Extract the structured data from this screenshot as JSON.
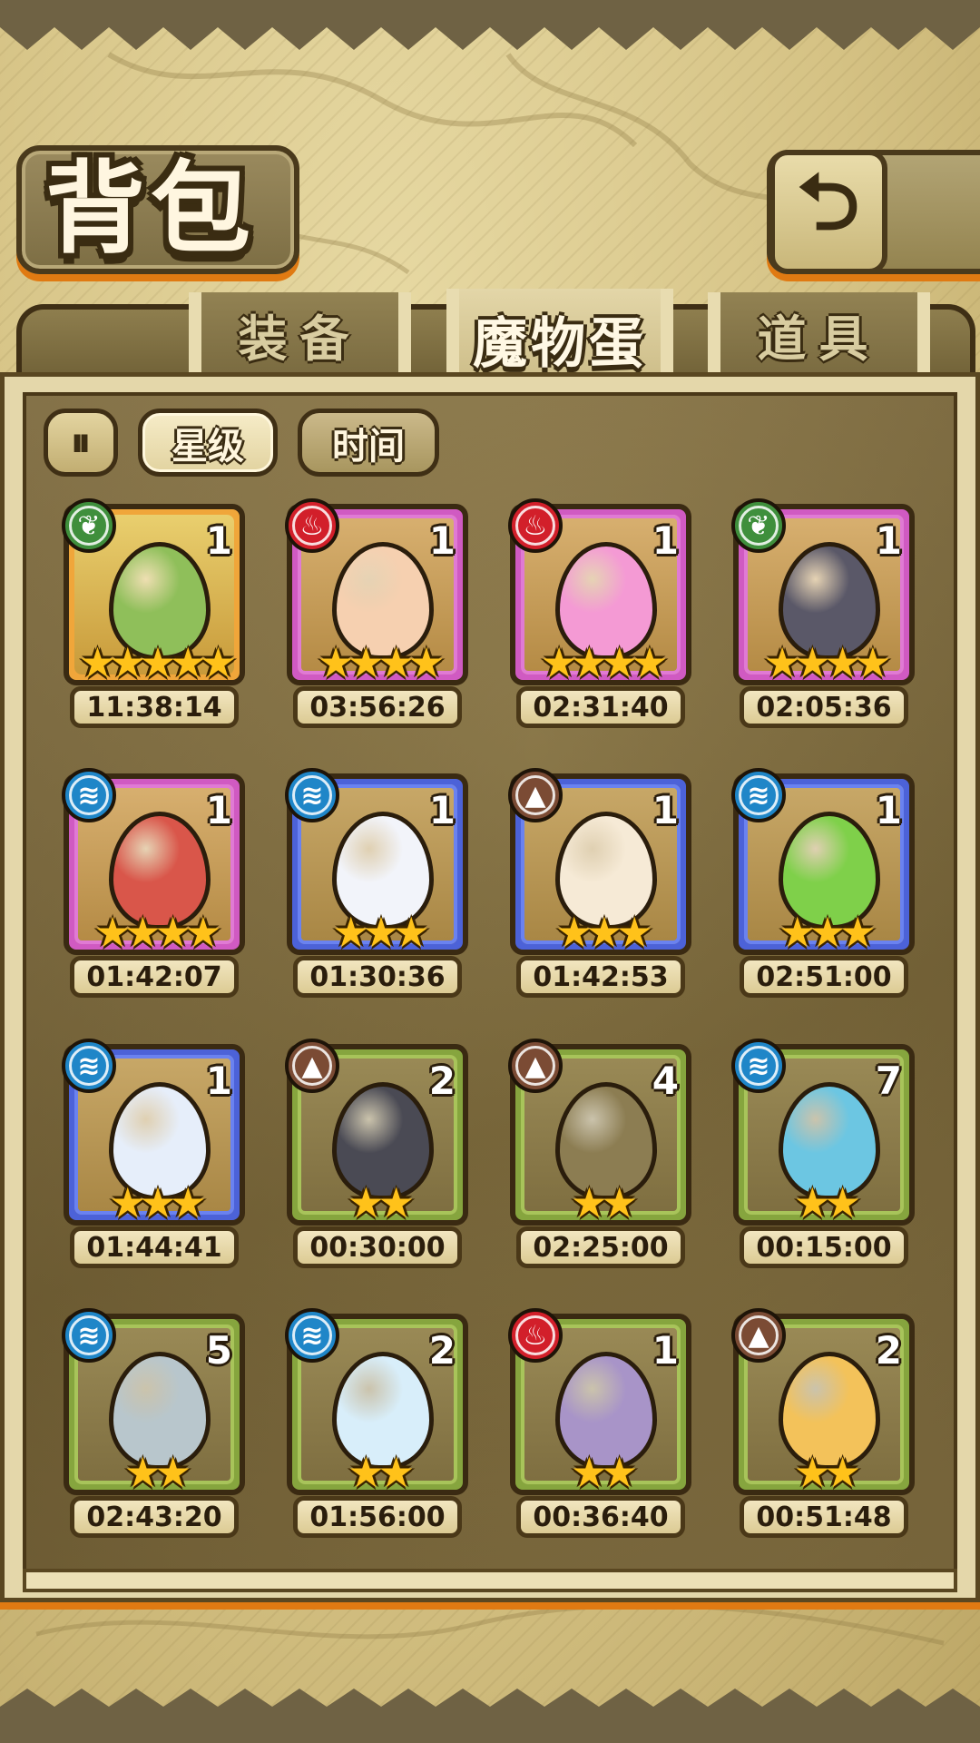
{
  "header": {
    "title": "背包",
    "back_icon": "back-arrow-icon"
  },
  "tabs": [
    {
      "label": "装备",
      "active": false
    },
    {
      "label": "魔物蛋",
      "active": true
    },
    {
      "label": "道具",
      "active": false
    }
  ],
  "sort": {
    "toggle_icon": "sort-toggle-icon",
    "star_label": "星级",
    "time_label": "时间"
  },
  "eggs": [
    {
      "element": "leaf",
      "count": "1",
      "stars": "★★★★★",
      "timer": "11:38:14",
      "frame": "gold",
      "color": "#8fbf5a"
    },
    {
      "element": "fire",
      "count": "1",
      "stars": "★★★★",
      "timer": "03:56:26",
      "frame": "pink",
      "color": "#f6d0b0"
    },
    {
      "element": "fire",
      "count": "1",
      "stars": "★★★★",
      "timer": "02:31:40",
      "frame": "pink",
      "color": "#f49ad4"
    },
    {
      "element": "leaf",
      "count": "1",
      "stars": "★★★★",
      "timer": "02:05:36",
      "frame": "pink",
      "color": "#5a5868"
    },
    {
      "element": "water",
      "count": "1",
      "stars": "★★★★",
      "timer": "01:42:07",
      "frame": "pink",
      "color": "#d9564a"
    },
    {
      "element": "water",
      "count": "1",
      "stars": "★★★",
      "timer": "01:30:36",
      "frame": "blue",
      "color": "#f2f4fa"
    },
    {
      "element": "earth",
      "count": "1",
      "stars": "★★★",
      "timer": "01:42:53",
      "frame": "blue",
      "color": "#f6ead6"
    },
    {
      "element": "water",
      "count": "1",
      "stars": "★★★",
      "timer": "02:51:00",
      "frame": "blue",
      "color": "#7fd04a"
    },
    {
      "element": "water",
      "count": "1",
      "stars": "★★★",
      "timer": "01:44:41",
      "frame": "blue",
      "color": "#e6eefa"
    },
    {
      "element": "earth",
      "count": "2",
      "stars": "★★",
      "timer": "00:30:00",
      "frame": "green",
      "color": "#4a4a54"
    },
    {
      "element": "earth",
      "count": "4",
      "stars": "★★",
      "timer": "02:25:00",
      "frame": "green",
      "color": "#8c7d52"
    },
    {
      "element": "water",
      "count": "7",
      "stars": "★★",
      "timer": "00:15:00",
      "frame": "green",
      "color": "#6cc6e2"
    },
    {
      "element": "water",
      "count": "5",
      "stars": "★★",
      "timer": "02:43:20",
      "frame": "green",
      "color": "#b8c6cc"
    },
    {
      "element": "water",
      "count": "2",
      "stars": "★★",
      "timer": "01:56:00",
      "frame": "green",
      "color": "#d8eefa"
    },
    {
      "element": "fire",
      "count": "1",
      "stars": "★★",
      "timer": "00:36:40",
      "frame": "green",
      "color": "#a894c8"
    },
    {
      "element": "earth",
      "count": "2",
      "stars": "★★",
      "timer": "00:51:48",
      "frame": "green",
      "color": "#f3c25a"
    }
  ],
  "colors": {
    "accent_orange": "#e07a12",
    "frame_dark": "#3a2a12",
    "star_gold": "#ffc21a"
  }
}
